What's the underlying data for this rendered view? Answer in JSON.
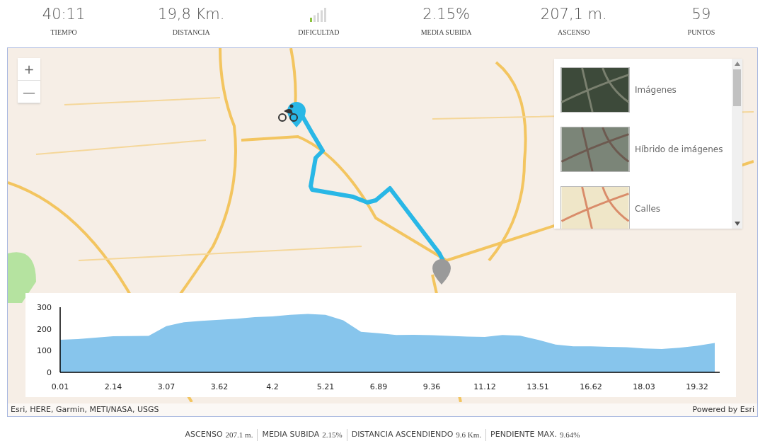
{
  "stats": [
    {
      "kind": "text",
      "value": "40:11",
      "label": "TIEMPO"
    },
    {
      "kind": "text",
      "value": "19,8 Km.",
      "label": "DISTANCIA"
    },
    {
      "kind": "meter",
      "level": 0.2,
      "label": "DIFICULTAD"
    },
    {
      "kind": "text",
      "value": "2.15%",
      "label": "MEDIA SUBIDA"
    },
    {
      "kind": "text",
      "value": "207,1 m.",
      "label": "ASCENSO"
    },
    {
      "kind": "text",
      "value": "59",
      "label": "PUNTOS"
    }
  ],
  "map": {
    "zoom_buttons": [
      "+",
      "—"
    ],
    "basemaps": [
      {
        "label": "Imágenes",
        "kind": "satellite"
      },
      {
        "label": "Híbrido de imágenes",
        "kind": "hybrid"
      },
      {
        "label": "Calles",
        "kind": "streets"
      }
    ],
    "attribution": "Esri, HERE, Garmin, METI/NASA, USGS",
    "powered_by": "Powered by Esri",
    "elevation": {
      "chart_data": {
        "type": "area",
        "categories": [
          "0.01",
          null,
          null,
          "2.14",
          null,
          null,
          "3.07",
          null,
          null,
          "3.62",
          null,
          null,
          "4.2",
          null,
          null,
          "5.21",
          null,
          null,
          "6.89",
          null,
          null,
          "9.36",
          null,
          null,
          "11.12",
          null,
          null,
          "13.51",
          null,
          null,
          "16.62",
          null,
          null,
          "18.03",
          null,
          null,
          "19.32",
          null
        ],
        "series": [
          {
            "color": "#87c5ec",
            "values": [
              150,
              153,
              160,
              166,
              167,
              168,
              213,
              231,
              237,
              242,
              247,
              254,
              258,
              265,
              269,
              265,
              240,
              187,
              180,
              172,
              173,
              171,
              168,
              165,
              163,
              172,
              169,
              150,
              128,
              120,
              120,
              117,
              116,
              110,
              108,
              113,
              122,
              135
            ]
          }
        ],
        "ylim": [
          0,
          300
        ],
        "yticks": [
          0,
          100,
          200,
          300
        ]
      }
    }
  },
  "summary": [
    {
      "label": "ASCENSO",
      "value": "207.1 m."
    },
    {
      "label": "MEDIA SUBIDA",
      "value": "2.15%"
    },
    {
      "label": "DISTANCIA ASCENDIENDO",
      "value": "9.6 Km."
    },
    {
      "label": "PENDIENTE MAX.",
      "value": "9.64%"
    }
  ]
}
